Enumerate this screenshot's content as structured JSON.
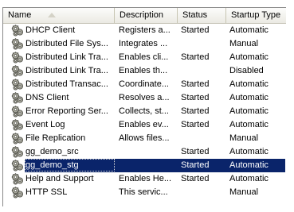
{
  "columns": {
    "name": "Name",
    "description": "Description",
    "status": "Status",
    "startup_type": "Startup Type"
  },
  "selected_row": 10,
  "rows": [
    {
      "name": "DHCP Client",
      "description": "Registers a...",
      "status": "Started",
      "startup": "Automatic"
    },
    {
      "name": "Distributed File Sys...",
      "description": "Integrates ...",
      "status": "",
      "startup": "Manual"
    },
    {
      "name": "Distributed Link Tra...",
      "description": "Enables cli...",
      "status": "Started",
      "startup": "Automatic"
    },
    {
      "name": "Distributed Link Tra...",
      "description": "Enables th...",
      "status": "",
      "startup": "Disabled"
    },
    {
      "name": "Distributed Transac...",
      "description": "Coordinate...",
      "status": "Started",
      "startup": "Automatic"
    },
    {
      "name": "DNS Client",
      "description": "Resolves a...",
      "status": "Started",
      "startup": "Automatic"
    },
    {
      "name": "Error Reporting Ser...",
      "description": "Collects, st...",
      "status": "Started",
      "startup": "Automatic"
    },
    {
      "name": "Event Log",
      "description": "Enables ev...",
      "status": "Started",
      "startup": "Automatic"
    },
    {
      "name": "File Replication",
      "description": "Allows files...",
      "status": "",
      "startup": "Manual"
    },
    {
      "name": "gg_demo_src",
      "description": "",
      "status": "Started",
      "startup": "Automatic"
    },
    {
      "name": "gg_demo_stg",
      "description": "",
      "status": "Started",
      "startup": "Automatic"
    },
    {
      "name": "Help and Support",
      "description": "Enables He...",
      "status": "Started",
      "startup": "Automatic"
    },
    {
      "name": "HTTP SSL",
      "description": "This servic...",
      "status": "",
      "startup": "Manual"
    }
  ],
  "icons": {
    "row_icon": "service-gears-icon",
    "sort_indicator": "sort-ascending-icon"
  },
  "colors": {
    "selection": "#0a246a",
    "header_bg": "#ebeae3"
  }
}
